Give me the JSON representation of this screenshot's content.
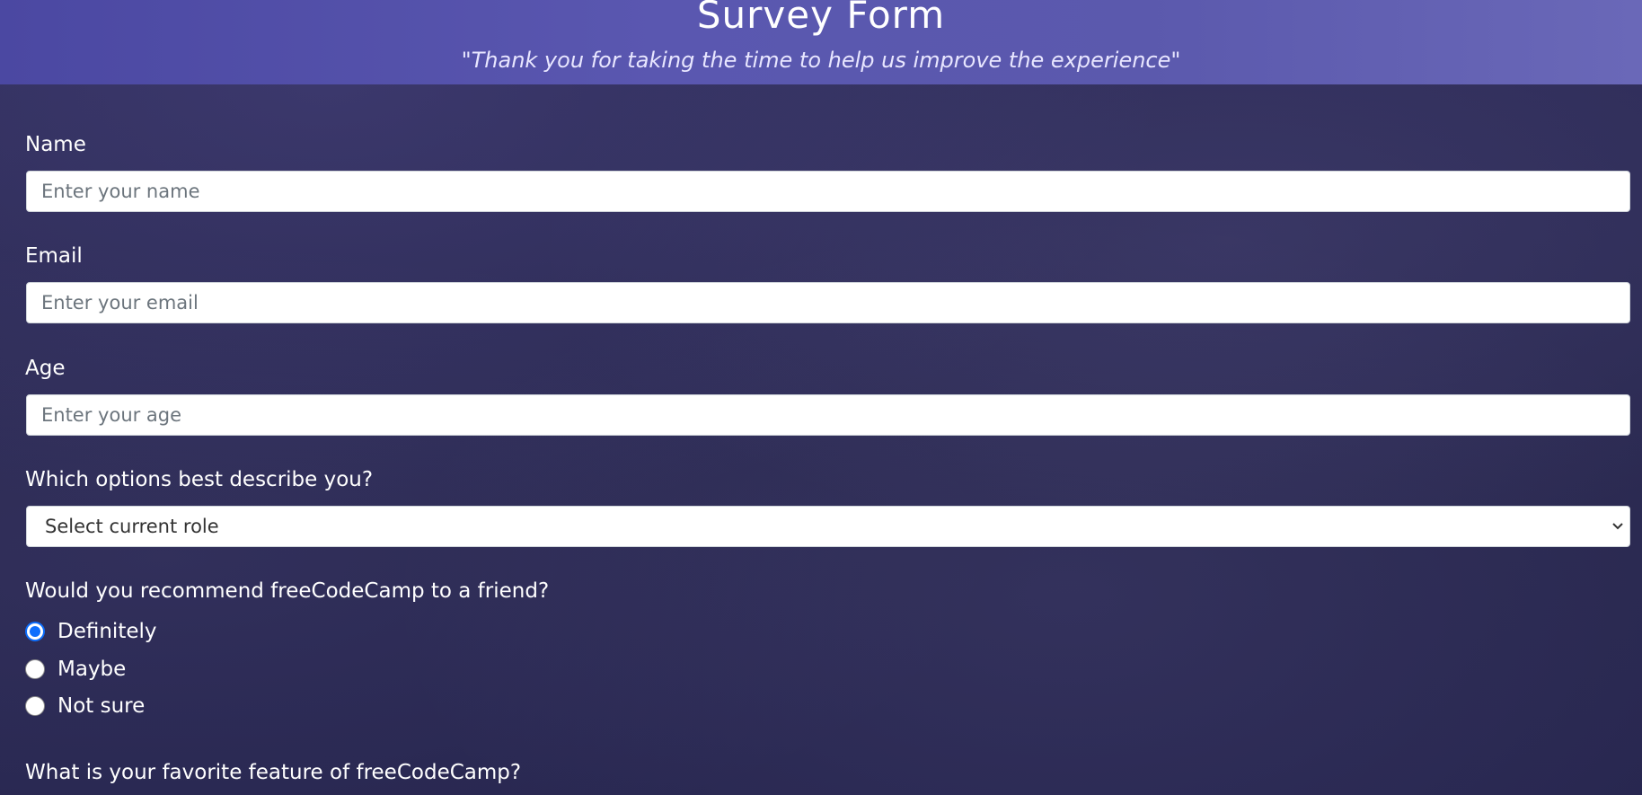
{
  "header": {
    "title": "Survey Form",
    "subtitle": "\"Thank you for taking the time to help us improve the experience\""
  },
  "form": {
    "name": {
      "label": "Name",
      "placeholder": "Enter your name"
    },
    "email": {
      "label": "Email",
      "placeholder": "Enter your email"
    },
    "age": {
      "label": "Age",
      "placeholder": "Enter your age"
    },
    "role": {
      "label": "Which options best describe you?",
      "selected": "Select current role"
    },
    "recommend": {
      "label": "Would you recommend freeCodeCamp to a friend?",
      "options": [
        {
          "label": "Definitely",
          "checked": true
        },
        {
          "label": "Maybe",
          "checked": false
        },
        {
          "label": "Not sure",
          "checked": false
        }
      ]
    },
    "favorite": {
      "label": "What is your favorite feature of freeCodeCamp?"
    }
  },
  "colors": {
    "header_bg": "#5553aa",
    "page_bg": "#2b2a52",
    "radio_accent": "#0d6efd"
  }
}
